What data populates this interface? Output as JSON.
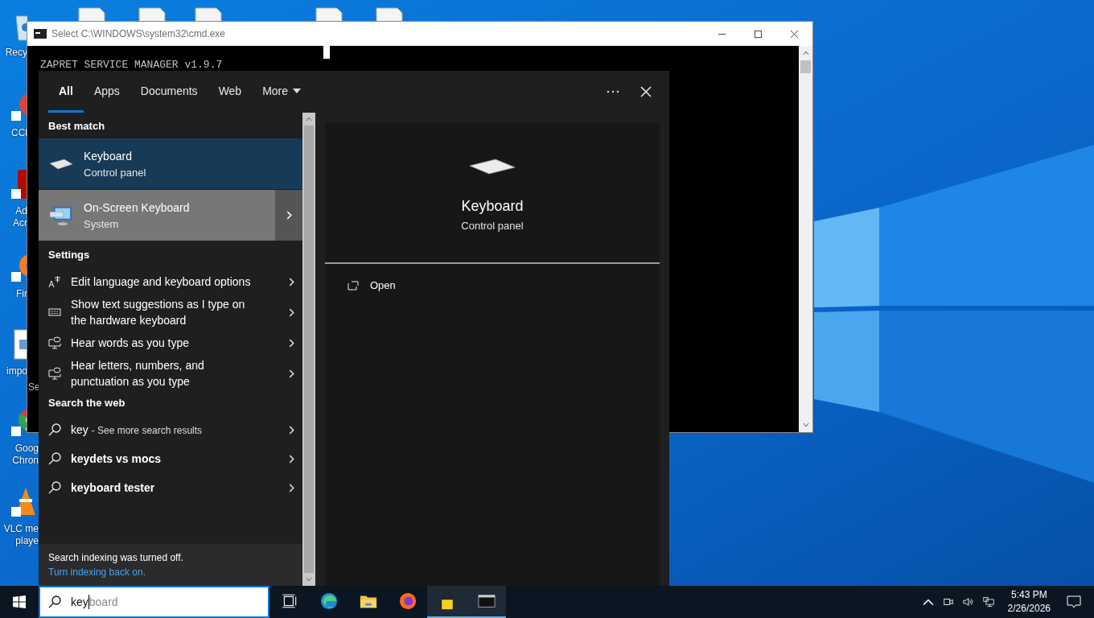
{
  "desktop": {
    "icons": [
      {
        "lines": [
          "Recy"
        ]
      },
      {
        "lines": [
          "CCl"
        ]
      },
      {
        "lines": [
          "Ad",
          "Acr"
        ]
      },
      {
        "lines": [
          "Fir"
        ]
      },
      {
        "lines": [
          "impo"
        ]
      },
      {
        "lines": [
          "Goog",
          "Chron"
        ]
      },
      {
        "lines": [
          "VLC me",
          "playe"
        ]
      }
    ],
    "label_fragment": "Se"
  },
  "cmd_window": {
    "title": "Select C:\\WINDOWS\\system32\\cmd.exe",
    "lines": [
      "ZAPRET SERVICE MANAGER v1.9.7"
    ]
  },
  "search_panel": {
    "tabs": [
      {
        "label": "All",
        "selected": true
      },
      {
        "label": "Apps",
        "selected": false
      },
      {
        "label": "Documents",
        "selected": false
      },
      {
        "label": "Web",
        "selected": false
      }
    ],
    "more": "More",
    "sections": [
      {
        "heading": "Best match",
        "items": [
          {
            "kind": "app",
            "title": "Keyboard",
            "subtitle": "Control panel",
            "selected": true,
            "hovered": false
          },
          {
            "kind": "app",
            "title": "On-Screen Keyboard",
            "subtitle": "System",
            "selected": false,
            "hovered": true
          }
        ]
      },
      {
        "heading": "Settings",
        "items": [
          {
            "kind": "setting",
            "title": "Edit language and keyboard options"
          },
          {
            "kind": "setting",
            "title": "Show text suggestions as I type on the hardware keyboard"
          },
          {
            "kind": "setting",
            "title": "Hear words as you type"
          },
          {
            "kind": "setting",
            "title": "Hear letters, numbers, and punctuation as you type"
          }
        ]
      },
      {
        "heading": "Search the web",
        "items": [
          {
            "kind": "query",
            "title": "key",
            "hint": "- See more search results"
          },
          {
            "kind": "suggestion",
            "title": "keydets vs mocs"
          },
          {
            "kind": "suggestion",
            "title": "keyboard tester"
          }
        ]
      }
    ],
    "footer": {
      "text": "Search indexing was turned off.",
      "link": "Turn indexing back on."
    },
    "preview": {
      "title": "Keyboard",
      "subtitle": "Control panel",
      "action": "Open"
    }
  },
  "taskbar": {
    "search": {
      "value": "key",
      "completion": "board"
    },
    "apps": [
      {
        "kind": "taskview",
        "active": false
      },
      {
        "kind": "edge",
        "active": false
      },
      {
        "kind": "explorer",
        "active": false
      },
      {
        "kind": "firefox",
        "active": false
      },
      {
        "kind": "lock",
        "active": true
      },
      {
        "kind": "cmd",
        "active": true
      }
    ],
    "time": "5:43 PM",
    "date": "2/26/2026"
  }
}
